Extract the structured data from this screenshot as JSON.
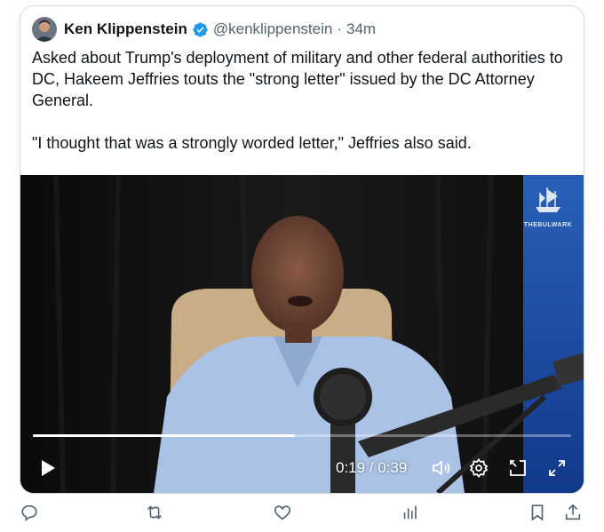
{
  "tweet": {
    "author_name": "Ken Klippenstein",
    "handle": "@kenklippenstein",
    "separator": "·",
    "time": "34m",
    "verified": true,
    "text_p1": "Asked about Trump's deployment of military and other federal authorities to DC, Hakeem Jeffries touts the \"strong letter\" issued by the DC Attorney General.",
    "text_p2": "\"I thought that was a strongly worded letter,\" Jeffries also said."
  },
  "video": {
    "watermark_text": "THEBULWARK",
    "timecode": "0:19 / 0:39",
    "progress": 0.487,
    "controls": [
      "play-icon",
      "volume-icon",
      "settings-icon",
      "picture-in-picture-icon",
      "fullscreen-icon"
    ]
  },
  "actions": [
    "reply-icon",
    "retweet-icon",
    "like-icon",
    "views-icon",
    "bookmark-icon",
    "share-icon"
  ],
  "colors": {
    "verified_badge": "#1d9bf0",
    "secondary_text": "#536471",
    "border": "#cfd9de",
    "icon": "#536471"
  }
}
